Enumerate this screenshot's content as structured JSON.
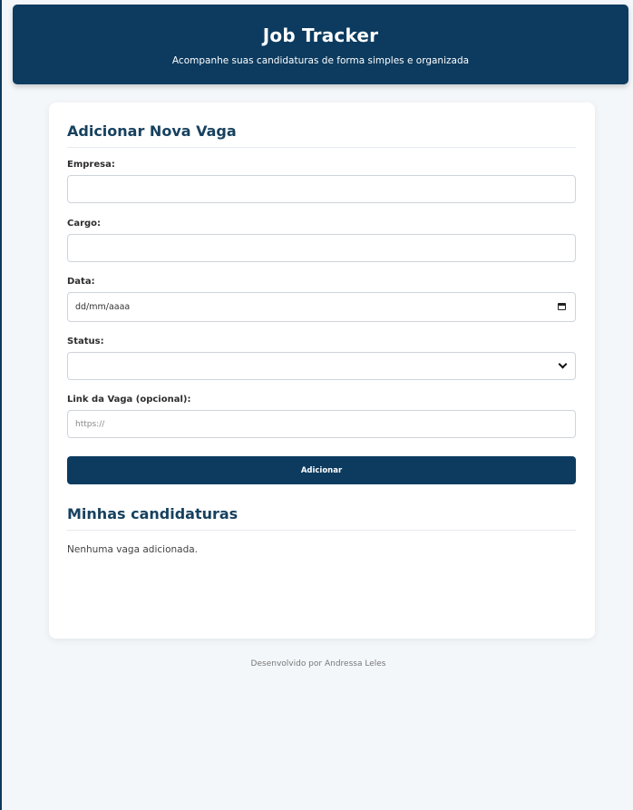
{
  "header": {
    "title": "Job Tracker",
    "subtitle": "Acompanhe suas candidaturas de forma simples e organizada"
  },
  "form": {
    "title": "Adicionar Nova Vaga",
    "empresa_label": "Empresa:",
    "empresa_value": "",
    "cargo_label": "Cargo:",
    "cargo_value": "",
    "data_label": "Data:",
    "data_placeholder": "dd/mm/aaaa",
    "status_label": "Status:",
    "status_value": "",
    "link_label": "Link da Vaga (opcional):",
    "link_placeholder": "https://",
    "submit_label": "Adicionar"
  },
  "list": {
    "title": "Minhas candidaturas",
    "empty_message": "Nenhuma vaga adicionada."
  },
  "footer": {
    "text": "Desenvolvido por Andressa Leles"
  },
  "colors": {
    "primary": "#0c3b5f",
    "heading": "#17415f",
    "background": "#f4f7fa"
  },
  "icons": {
    "date_field": "calendar-icon",
    "status_field": "chevron-down-icon"
  }
}
